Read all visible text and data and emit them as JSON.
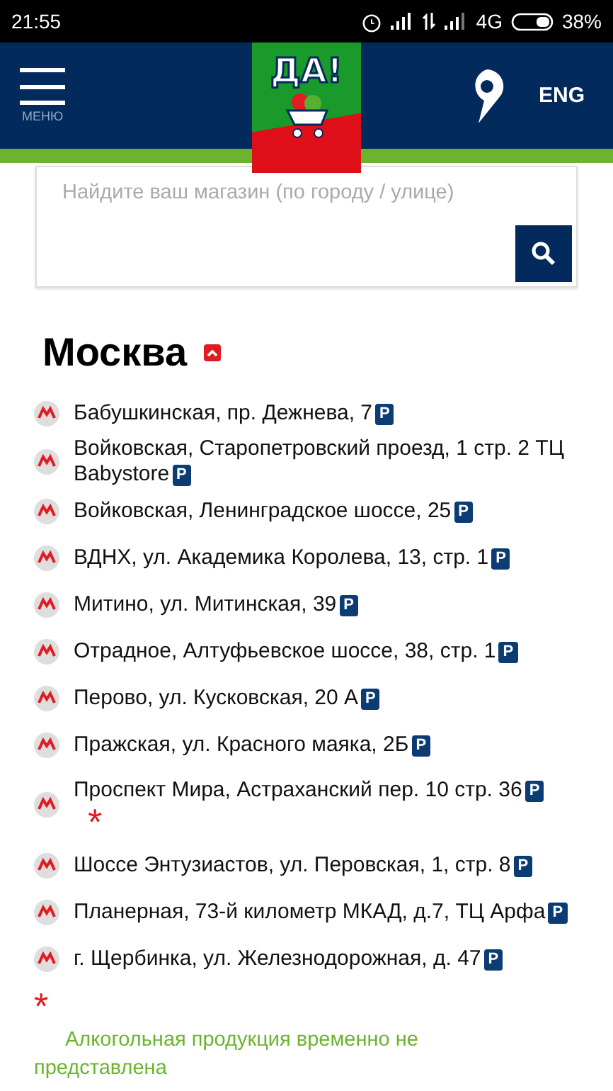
{
  "status_bar": {
    "time": "21:55",
    "network": "4G",
    "battery": "38%"
  },
  "header": {
    "menu_label": "МЕНЮ",
    "logo": "ДА!",
    "language": "ENG"
  },
  "search": {
    "placeholder": "Найдите ваш магазин (по городу / улице)"
  },
  "city": {
    "name": "Москва",
    "expanded": true
  },
  "stores": [
    {
      "address": "Бабушкинская, пр. Дежнева, 7",
      "parking": "P"
    },
    {
      "address": "Войковская, Старопетровский проезд, 1 стр. 2 ТЦ Babystore",
      "parking": "P"
    },
    {
      "address": "Войковская, Ленинградское шоссе, 25",
      "parking": "P"
    },
    {
      "address": "ВДНХ, ул. Академика Королева, 13, стр. 1",
      "parking": "P"
    },
    {
      "address": "Митино, ул. Митинская, 39",
      "parking": "P"
    },
    {
      "address": "Отрадное, Алтуфьевское шоссе, 38, стр. 1",
      "parking": "P"
    },
    {
      "address": "Перово, ул. Кусковская, 20 А",
      "parking": "P"
    },
    {
      "address": "Пражская, ул. Красного маяка, 2Б",
      "parking": "P"
    },
    {
      "address": "Проспект Мира, Астраханский пер. 10 стр. 36",
      "parking": "P",
      "note_mark": "*"
    },
    {
      "address": "Шоссе Энтузиастов, ул. Перовская, 1, стр. 8",
      "parking": "P"
    },
    {
      "address": "Планерная, 73-й километр МКАД, д.7, ТЦ Арфа",
      "parking": "P"
    },
    {
      "address": "г. Щербинка, ул. Железнодорожная, д. 47",
      "parking": "P"
    }
  ],
  "footnote": {
    "mark": "*",
    "text": "Алкогольная продукция временно не представлена"
  }
}
